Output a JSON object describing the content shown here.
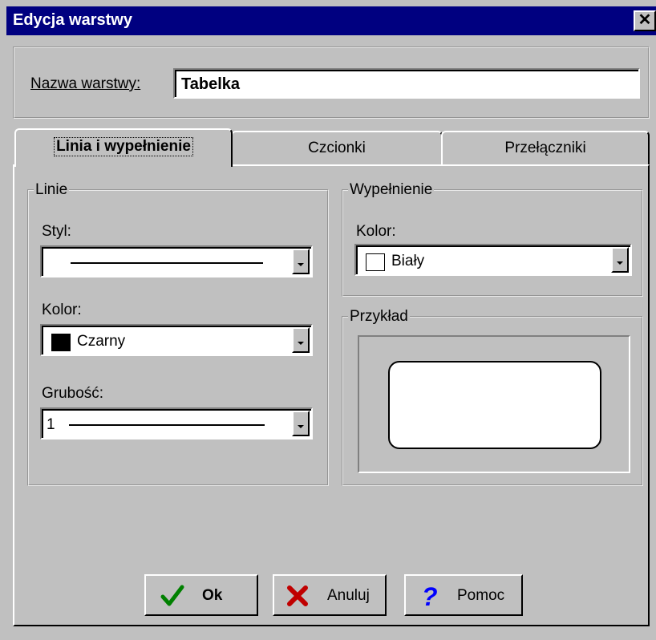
{
  "window": {
    "title": "Edycja warstwy",
    "close_glyph": "✕"
  },
  "layer_name": {
    "label": "Nazwa warstwy:",
    "value": "Tabelka"
  },
  "tabs": [
    {
      "label": "Linia i wypełnienie",
      "active": true
    },
    {
      "label": "Czcionki",
      "active": false
    },
    {
      "label": "Przełączniki",
      "active": false
    }
  ],
  "lines_group": {
    "title": "Linie",
    "style_label": "Styl:",
    "color_label": "Kolor:",
    "color_value": "Czarny",
    "color_swatch": "#000000",
    "thickness_label": "Grubość:",
    "thickness_value": "1"
  },
  "fill_group": {
    "title": "Wypełnienie",
    "color_label": "Kolor:",
    "color_value": "Biały",
    "color_swatch": "#ffffff"
  },
  "preview_group": {
    "title": "Przykład"
  },
  "buttons": {
    "ok": "Ok",
    "cancel": "Anuluj",
    "help": "Pomoc"
  },
  "icons": {
    "ok": "checkmark-icon",
    "cancel": "x-icon",
    "help": "question-mark-icon"
  },
  "colors": {
    "titlebar": "#000080",
    "face": "#c0c0c0",
    "ok_icon": "#008000",
    "cancel_icon": "#c00000",
    "help_icon": "#0000ff"
  }
}
